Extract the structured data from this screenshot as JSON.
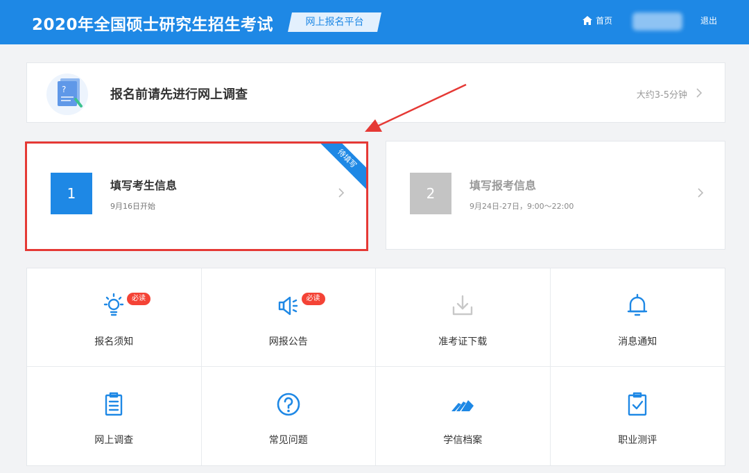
{
  "header": {
    "title": "2020年全国硕士研究生招生考试",
    "platform_tag": "网上报名平台",
    "home_label": "首页",
    "logout_label": "退出"
  },
  "survey": {
    "title": "报名前请先进行网上调查",
    "duration": "大约3-5分钟"
  },
  "steps": [
    {
      "number": "1",
      "title": "填写考生信息",
      "subtitle": "9月16日开始",
      "ribbon": "待填写",
      "status": "active"
    },
    {
      "number": "2",
      "title": "填写报考信息",
      "subtitle": "9月24日-27日，9:00～22:00",
      "status": "disabled"
    }
  ],
  "tiles": [
    {
      "label": "报名须知",
      "icon": "lightbulb-icon",
      "badge": "必读"
    },
    {
      "label": "网报公告",
      "icon": "megaphone-icon",
      "badge": "必读"
    },
    {
      "label": "准考证下载",
      "icon": "download-icon"
    },
    {
      "label": "消息通知",
      "icon": "bell-icon"
    },
    {
      "label": "网上调查",
      "icon": "clipboard-icon"
    },
    {
      "label": "常见问题",
      "icon": "question-circle-icon"
    },
    {
      "label": "学信档案",
      "icon": "archive-icon"
    },
    {
      "label": "职业测评",
      "icon": "clipboard-check-icon"
    }
  ],
  "colors": {
    "primary": "#1e88e5",
    "highlight": "#e53935",
    "badge": "#f44336",
    "disabled": "#c4c4c4"
  }
}
